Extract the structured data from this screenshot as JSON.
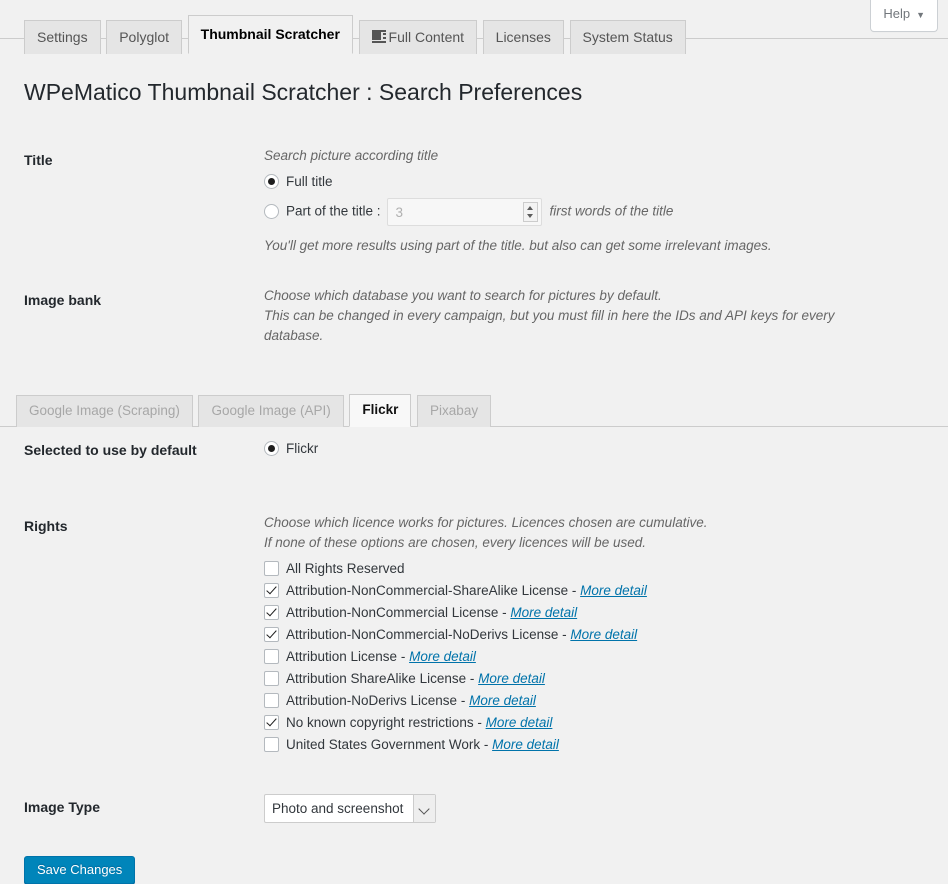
{
  "help": {
    "label": "Help",
    "caret": "chevron-down-icon"
  },
  "nav_tabs": [
    {
      "label": "Settings",
      "active": false,
      "icon": null
    },
    {
      "label": "Polyglot",
      "active": false,
      "icon": null
    },
    {
      "label": "Thumbnail Scratcher",
      "active": true,
      "icon": null
    },
    {
      "label": "Full Content",
      "active": false,
      "icon": "list-block-icon"
    },
    {
      "label": "Licenses",
      "active": false,
      "icon": null
    },
    {
      "label": "System Status",
      "active": false,
      "icon": null
    }
  ],
  "page_title": "WPeMatico Thumbnail Scratcher : Search Preferences",
  "title_section": {
    "label": "Title",
    "description": "Search picture according title",
    "option_full": "Full title",
    "option_part": "Part of the title :",
    "words_value": "3",
    "words_suffix": "first words of the title",
    "hint": "You'll get more results using part of the title. but also can get some irrelevant images."
  },
  "image_bank": {
    "label": "Image bank",
    "description_line1": "Choose which database you want to search for pictures by default.",
    "description_line2": "This can be changed in every campaign, but you must fill in here the IDs and API keys for every database.",
    "tabs": [
      {
        "label": "Google Image (Scraping)",
        "active": false
      },
      {
        "label": "Google Image (API)",
        "active": false
      },
      {
        "label": "Flickr",
        "active": true
      },
      {
        "label": "Pixabay",
        "active": false
      }
    ]
  },
  "selected_default": {
    "label": "Selected to use by default",
    "option": "Flickr"
  },
  "rights": {
    "label": "Rights",
    "description_line1": "Choose which licence works for pictures. Licences chosen are cumulative.",
    "description_line2": "If none of these options are chosen, every licences will be used.",
    "more_detail_label": "More detail",
    "items": [
      {
        "label": "All Rights Reserved",
        "checked": false,
        "has_link": false
      },
      {
        "label": "Attribution-NonCommercial-ShareAlike License",
        "checked": true,
        "has_link": true
      },
      {
        "label": "Attribution-NonCommercial License",
        "checked": true,
        "has_link": true
      },
      {
        "label": "Attribution-NonCommercial-NoDerivs License",
        "checked": true,
        "has_link": true
      },
      {
        "label": "Attribution License",
        "checked": false,
        "has_link": true
      },
      {
        "label": "Attribution ShareAlike License",
        "checked": false,
        "has_link": true
      },
      {
        "label": "Attribution-NoDerivs License",
        "checked": false,
        "has_link": true
      },
      {
        "label": "No known copyright restrictions",
        "checked": true,
        "has_link": true
      },
      {
        "label": "United States Government Work",
        "checked": false,
        "has_link": true
      }
    ]
  },
  "image_type": {
    "label": "Image Type",
    "selected": "Photo and screenshot"
  },
  "submit": {
    "label": "Save Changes"
  },
  "colors": {
    "page_background": "#f1f1f1",
    "link": "#0073aa",
    "primary_button": "#0085ba",
    "heading": "#23282d",
    "muted_text": "#666666"
  }
}
